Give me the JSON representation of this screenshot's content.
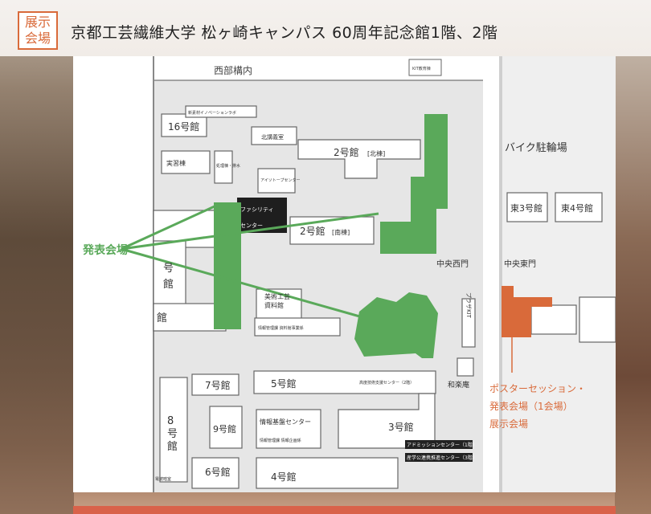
{
  "badge": {
    "line1": "展示",
    "line2": "会場"
  },
  "title": "京都工芸繊維大学 松ヶ崎キャンパス 60周年記念館1階、2階",
  "colors": {
    "accent": "#d96a3a",
    "venue_green": "#5aa95a",
    "grey_block": "#cfcfcf",
    "road": "#e8e8e8"
  },
  "map": {
    "labels": {
      "west_area": "西部構内",
      "bldg16": "16号館",
      "new_material_lab": "新素材イノベーションラボ",
      "north_lecture": "北講義室",
      "training": "実習棟",
      "waste": "処理棟・排水",
      "isotope": "アイソトープセンター",
      "bldg2n": "2号館",
      "bldg2n_suffix": "[北棟]",
      "bldg2s": "2号館",
      "bldg2s_suffix": "[南棟]",
      "facility": "ファシリティ",
      "center": "センター",
      "bike": "バイク駐輪場",
      "east3": "東3号館",
      "east4": "東4号館",
      "central_west_gate": "中央西門",
      "central_east_gate": "中央東門",
      "museum1": "美術工芸",
      "museum2": "資料館",
      "info_mgmt": "情報管理課 資料館事業係",
      "plaza": "プラザKIT",
      "kanji_fragment_go": "号",
      "kanji_fragment_kan": "館",
      "kanji_fragment_kan2": "館",
      "kit_shop": "KIT教育棟",
      "bldg7": "7号館",
      "bldg5": "5号館",
      "advanced_tech": "高度技術支援センター（2階）",
      "wagaku": "和楽庵",
      "bldg8a": "8",
      "bldg8b": "号",
      "bldg8c": "館",
      "bldg9": "9号館",
      "info_infra": "情報基盤センター",
      "info_sub": "情報管理課 情報企画係",
      "bldg3": "3号館",
      "admission": "アドミッションセンター（1階）",
      "scholarship": "産学公連携推進センター（3階）",
      "bldg6": "6号館",
      "bldg4": "4号館",
      "elec": "電波暗室"
    },
    "callouts": {
      "presentation_venue": "発表会場",
      "poster_line1": "ポスターセッション・",
      "poster_line2": "発表会場（1会場）",
      "poster_line3": "展示会場"
    }
  }
}
